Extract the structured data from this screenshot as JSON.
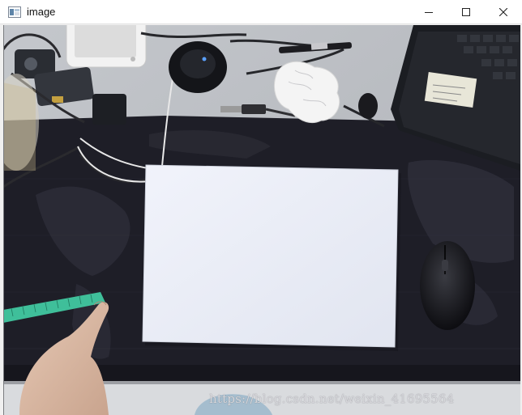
{
  "window": {
    "title": "image",
    "controls": [
      "minimize-icon",
      "maximize-icon",
      "close-icon"
    ]
  },
  "image": {
    "watermark": "https://blog.csdn.net/weixin_41695564"
  },
  "colors": {
    "desk_mat": "#1e1e27",
    "paper": "#e9ecf5",
    "measuring_tape": "#3fbf9a",
    "keyboard": "#1b1d22"
  }
}
